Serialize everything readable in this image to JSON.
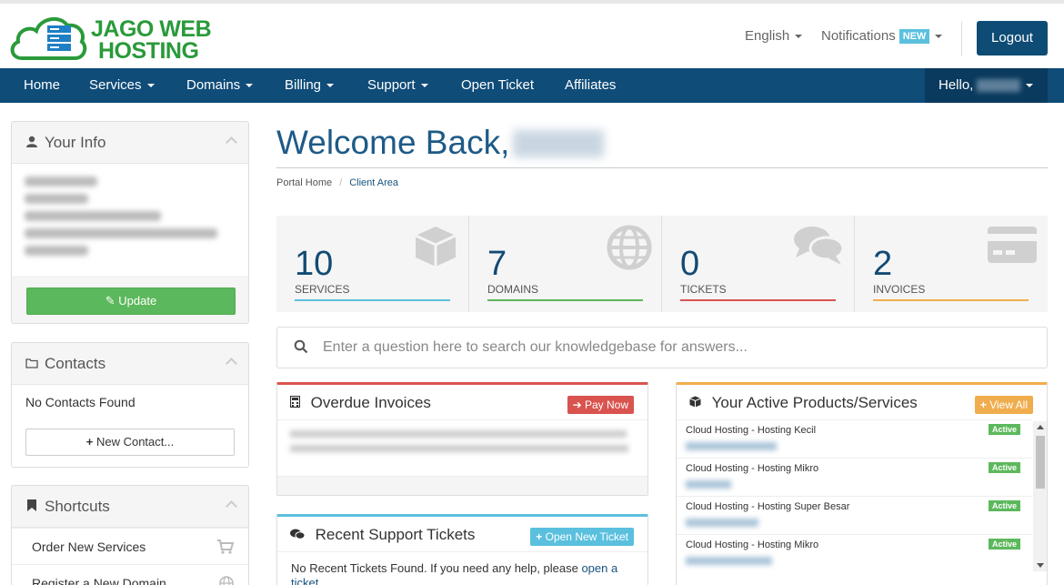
{
  "brand": {
    "line1": "JAGO WEB",
    "line2": "HOSTING"
  },
  "header": {
    "language": "English",
    "notifications": "Notifications",
    "new_badge": "NEW",
    "logout": "Logout"
  },
  "nav": {
    "items": [
      {
        "label": "Home",
        "dropdown": false
      },
      {
        "label": "Services",
        "dropdown": true
      },
      {
        "label": "Domains",
        "dropdown": true
      },
      {
        "label": "Billing",
        "dropdown": true
      },
      {
        "label": "Support",
        "dropdown": true
      },
      {
        "label": "Open Ticket",
        "dropdown": false
      },
      {
        "label": "Affiliates",
        "dropdown": false
      }
    ],
    "hello": "Hello,"
  },
  "sidebar": {
    "your_info": {
      "title": "Your Info",
      "update": "Update"
    },
    "contacts": {
      "title": "Contacts",
      "empty": "No Contacts Found",
      "new_contact": "New Contact..."
    },
    "shortcuts": {
      "title": "Shortcuts",
      "items": [
        "Order New Services",
        "Register a New Domain"
      ]
    }
  },
  "main": {
    "welcome": "Welcome Back,",
    "breadcrumb": [
      "Portal Home",
      "Client Area"
    ],
    "stats": [
      {
        "value": "10",
        "label": "SERVICES",
        "color": "#5bc0de"
      },
      {
        "value": "7",
        "label": "DOMAINS",
        "color": "#5cb85c"
      },
      {
        "value": "0",
        "label": "TICKETS",
        "color": "#d9534f"
      },
      {
        "value": "2",
        "label": "INVOICES",
        "color": "#f0ad4e"
      }
    ],
    "kb_placeholder": "Enter a question here to search our knowledgebase for answers...",
    "overdue": {
      "title": "Overdue Invoices",
      "button": "Pay Now"
    },
    "tickets": {
      "title": "Recent Support Tickets",
      "button": "Open New Ticket",
      "empty_text": "No Recent Tickets Found. If you need any help, please",
      "link_text": "open a ticket"
    },
    "products": {
      "title": "Your Active Products/Services",
      "button": "View All",
      "items": [
        {
          "name": "Cloud Hosting - Hosting Kecil",
          "status": "Active"
        },
        {
          "name": "Cloud Hosting - Hosting Mikro",
          "status": "Active"
        },
        {
          "name": "Cloud Hosting - Hosting Super Besar",
          "status": "Active"
        },
        {
          "name": "Cloud Hosting - Hosting Mikro",
          "status": "Active"
        }
      ]
    }
  },
  "colors": {
    "brand_green": "#2a9a3a",
    "nav_blue": "#0f4c78",
    "success": "#5cb85c",
    "danger": "#d9534f",
    "warning": "#f0ad4e",
    "info": "#5bc0de"
  }
}
